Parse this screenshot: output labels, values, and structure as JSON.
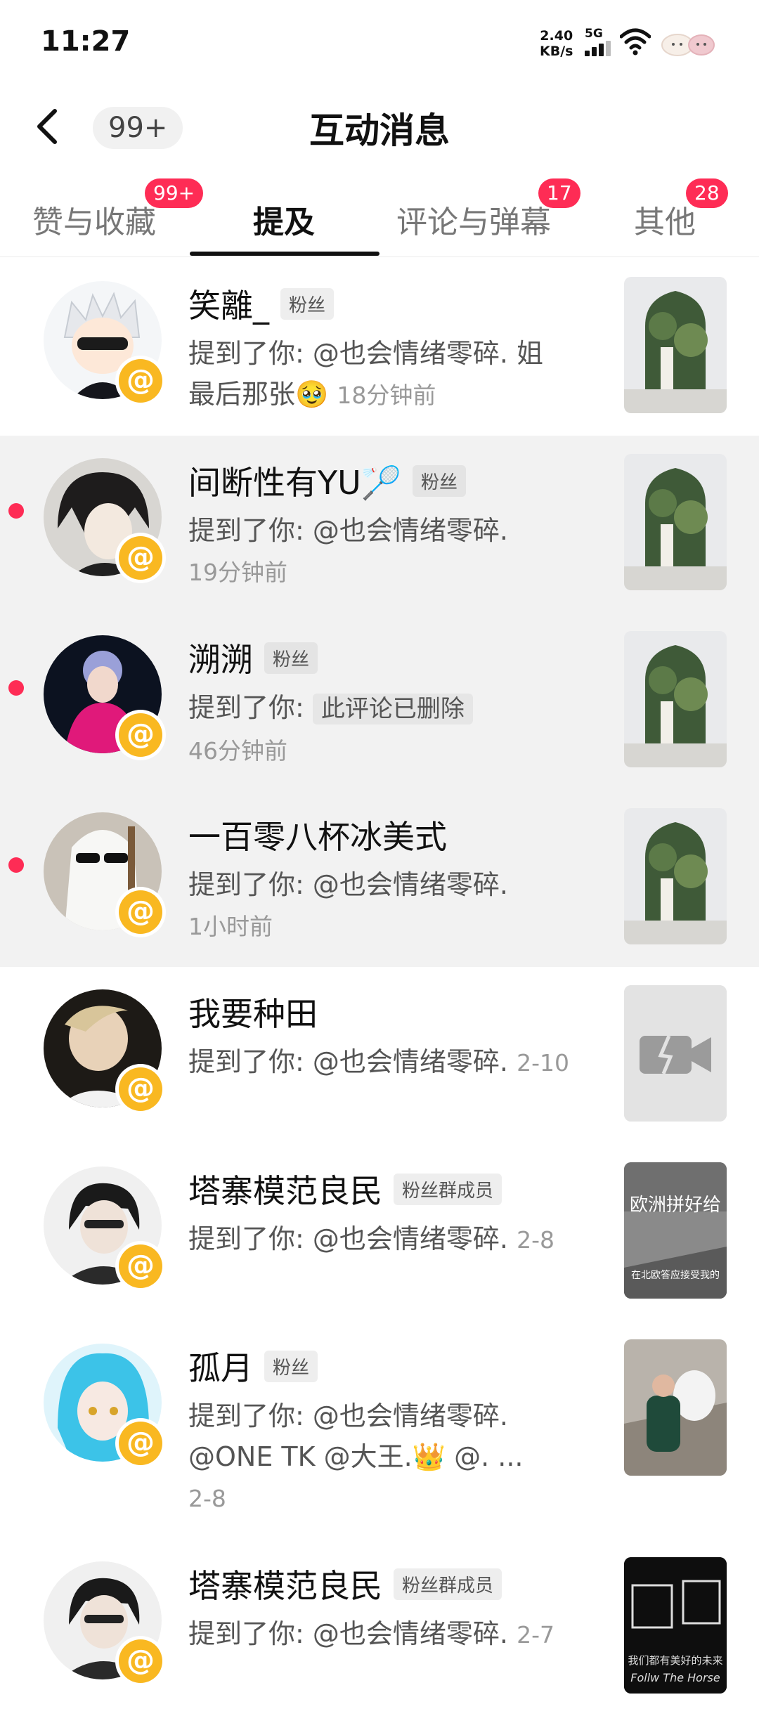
{
  "status": {
    "time": "11:27",
    "speed": "2.40",
    "speed_unit": "KB/s",
    "network": "5G"
  },
  "header": {
    "back_icon": "back-arrow-icon",
    "badge": "99+",
    "title": "互动消息"
  },
  "tabs": [
    {
      "label": "赞与收藏",
      "badge": "99+"
    },
    {
      "label": "提及",
      "badge": ""
    },
    {
      "label": "评论与弹幕",
      "badge": "17"
    },
    {
      "label": "其他",
      "badge": "28"
    }
  ],
  "notifications": [
    {
      "name": "笑離_",
      "tag": "粉丝",
      "prefix": "提到了你: ",
      "text": "@也会情绪零碎. 姐",
      "text2": "最后那张🥹",
      "time": "18分钟前",
      "unread": false
    },
    {
      "name": "间断性有YU🏸",
      "tag": "粉丝",
      "prefix": "提到了你: ",
      "text": "@也会情绪零碎.",
      "time": "19分钟前",
      "unread": true
    },
    {
      "name": "溯溯",
      "tag": "粉丝",
      "prefix": "提到了你: ",
      "deleted": "此评论已删除",
      "time": "46分钟前",
      "unread": true
    },
    {
      "name": "一百零八杯冰美式",
      "tag": "",
      "prefix": "提到了你: ",
      "text": "@也会情绪零碎.",
      "time": "1小时前",
      "unread": true
    },
    {
      "name": "我要种田",
      "tag": "",
      "prefix": "提到了你: ",
      "text": "@也会情绪零碎.",
      "time": "2-10",
      "unread": false
    },
    {
      "name": "塔寨模范良民",
      "tag": "粉丝群成员",
      "prefix": "提到了你: ",
      "text": "@也会情绪零碎.",
      "time": "2-8",
      "unread": false,
      "thumb_caption_top": "欧洲拼好给",
      "thumb_caption_bottom": "在北欧答应接受我的"
    },
    {
      "name": "孤月",
      "tag": "粉丝",
      "prefix": "提到了你: ",
      "text": "@也会情绪零碎.",
      "text2": "@ONE TK @大王.👑 @.   ...",
      "time": "2-8",
      "unread": false
    },
    {
      "name": "塔寨模范良民",
      "tag": "粉丝群成员",
      "prefix": "提到了你: ",
      "text": "@也会情绪零碎.",
      "time": "2-7",
      "unread": false,
      "thumb_caption_top": "我们都有美好的未来",
      "thumb_caption_bottom": "Follw The Horse"
    }
  ],
  "at_symbol": "@",
  "colors": {
    "accent": "#fe2c55",
    "at_badge": "#f9b821",
    "unread_bg": "#f2f2f2"
  }
}
